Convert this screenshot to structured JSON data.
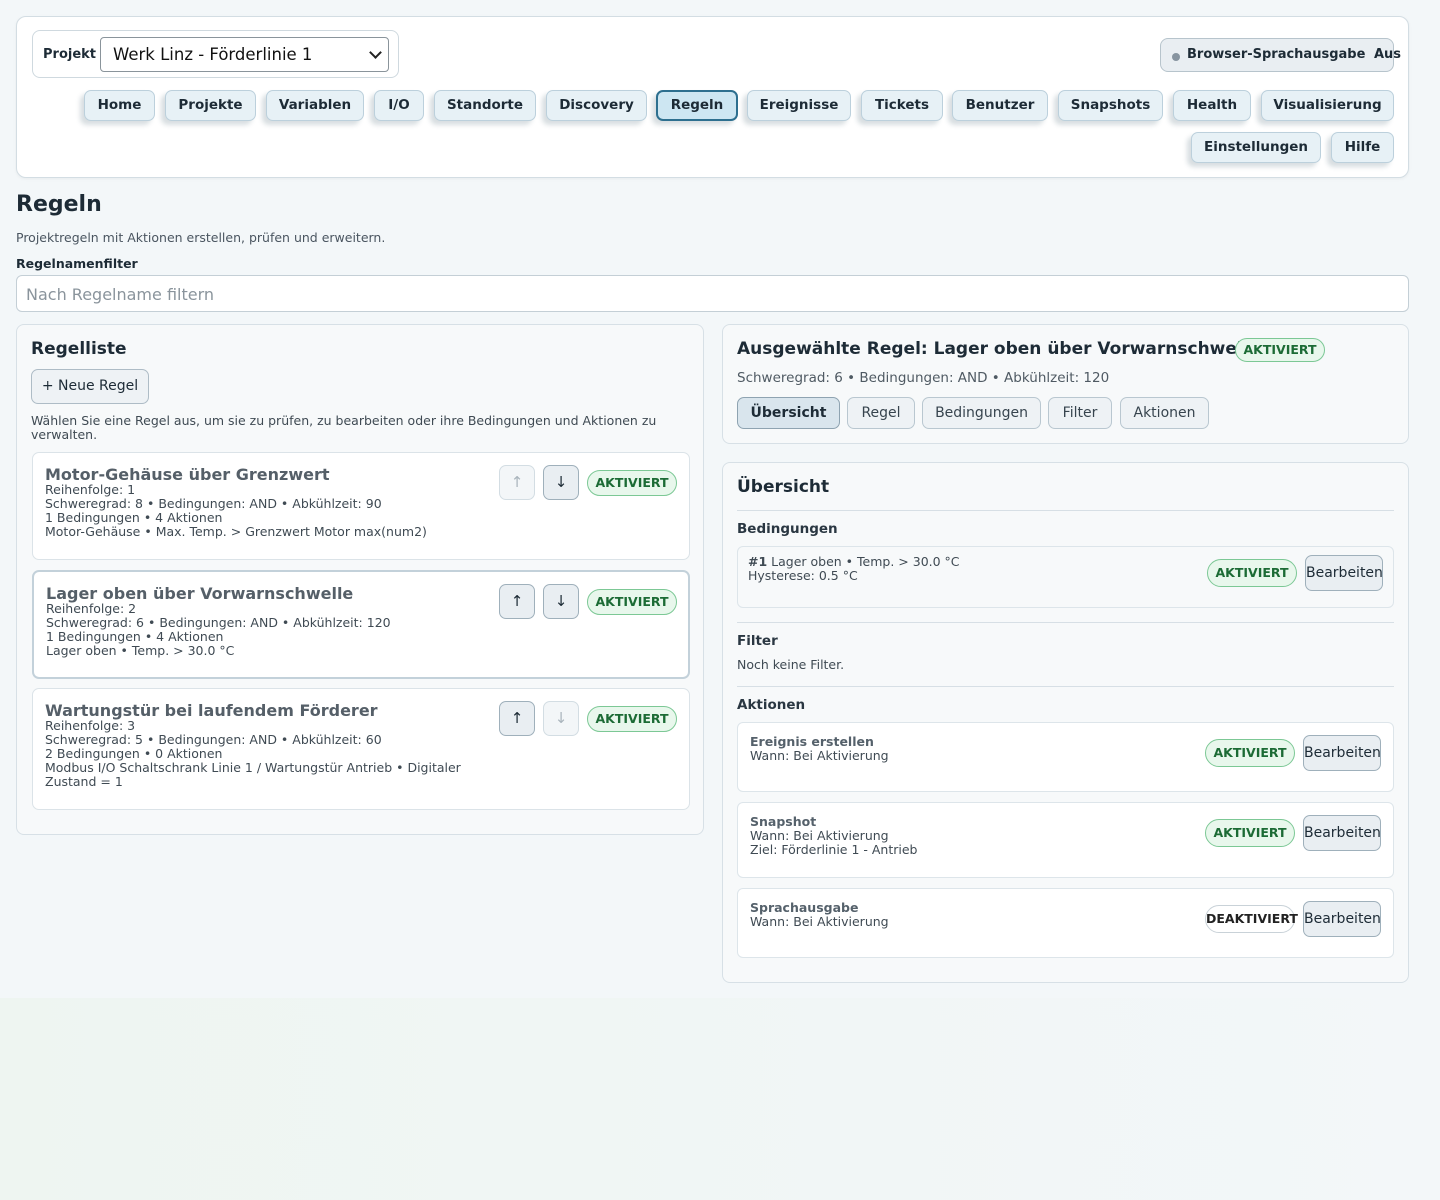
{
  "header": {
    "project_label": "Projekt",
    "project_value": "Werk Linz - Förderlinie 1",
    "speech_label": "Browser-Sprachausgabe",
    "speech_state": "Aus",
    "nav": [
      "Home",
      "Projekte",
      "Variablen",
      "I/O",
      "Standorte",
      "Discovery",
      "Regeln",
      "Ereignisse",
      "Tickets",
      "Benutzer",
      "Snapshots",
      "Health",
      "Visualisierung",
      "Einstellungen",
      "Hilfe"
    ],
    "active_nav": "Regeln"
  },
  "page": {
    "title": "Regeln",
    "subtitle": "Projektregeln mit Aktionen erstellen, prüfen und erweitern.",
    "filter_label": "Regelnamenfilter",
    "filter_placeholder": "Nach Regelname filtern"
  },
  "rule_list": {
    "title": "Regelliste",
    "new_button": "+ Neue Regel",
    "hint": "Wählen Sie eine Regel aus, um sie zu prüfen, zu bearbeiten oder ihre Bedingungen und Aktionen zu verwalten.",
    "rules": [
      {
        "name": "Motor-Gehäuse über Grenzwert",
        "order": "Reihenfolge: 1",
        "meta": "Schweregrad: 8 • Bedingungen: AND • Abkühlzeit: 90",
        "counts": "1 Bedingungen • 4 Aktionen",
        "condition": "Motor-Gehäuse • Max. Temp. > Grenzwert Motor max(num2)",
        "condition2": "",
        "status": "AKTIVIERT"
      },
      {
        "name": "Lager oben über Vorwarnschwelle",
        "order": "Reihenfolge: 2",
        "meta": "Schweregrad: 6 • Bedingungen: AND • Abkühlzeit: 120",
        "counts": "1 Bedingungen • 4 Aktionen",
        "condition": "Lager oben • Temp. > 30.0 °C",
        "condition2": "",
        "status": "AKTIVIERT"
      },
      {
        "name": "Wartungstür bei laufendem Förderer",
        "order": "Reihenfolge: 3",
        "meta": "Schweregrad: 5 • Bedingungen: AND • Abkühlzeit: 60",
        "counts": "2 Bedingungen • 0 Aktionen",
        "condition": "Modbus I/O Schaltschrank Linie 1 / Wartungstür Antrieb • Digitaler",
        "condition2": "Zustand = 1",
        "status": "AKTIVIERT"
      }
    ],
    "up_arrow": "↑",
    "down_arrow": "↓"
  },
  "selected": {
    "title": "Ausgewählte Regel: Lager oben über Vorwarnschwelle",
    "status": "AKTIVIERT",
    "meta": "Schweregrad: 6 • Bedingungen: AND • Abkühlzeit: 120",
    "tabs": [
      "Übersicht",
      "Regel",
      "Bedingungen",
      "Filter",
      "Aktionen"
    ],
    "active_tab": "Übersicht"
  },
  "overview": {
    "title": "Übersicht",
    "conditions_title": "Bedingungen",
    "condition": {
      "num": "#1",
      "text": "Lager oben • Temp. > 30.0 °C",
      "hysteresis": "Hysterese: 0.5 °C",
      "status": "AKTIVIERT",
      "edit": "Bearbeiten"
    },
    "filter_title": "Filter",
    "filter_empty": "Noch keine Filter.",
    "actions_title": "Aktionen",
    "actions": [
      {
        "name": "Ereignis erstellen",
        "when": "Wann: Bei Aktivierung",
        "target": "",
        "status": "AKTIVIERT",
        "edit": "Bearbeiten"
      },
      {
        "name": "Snapshot",
        "when": "Wann: Bei Aktivierung",
        "target": "Ziel: Förderlinie 1 - Antrieb",
        "status": "AKTIVIERT",
        "edit": "Bearbeiten"
      },
      {
        "name": "Sprachausgabe",
        "when": "Wann: Bei Aktivierung",
        "target": "",
        "status": "DEAKTIVIERT",
        "edit": "Bearbeiten"
      }
    ]
  },
  "colors": {
    "accent": "#2d6f8f",
    "active_badge": "#1c6b35",
    "background": "#f3f7f9"
  }
}
